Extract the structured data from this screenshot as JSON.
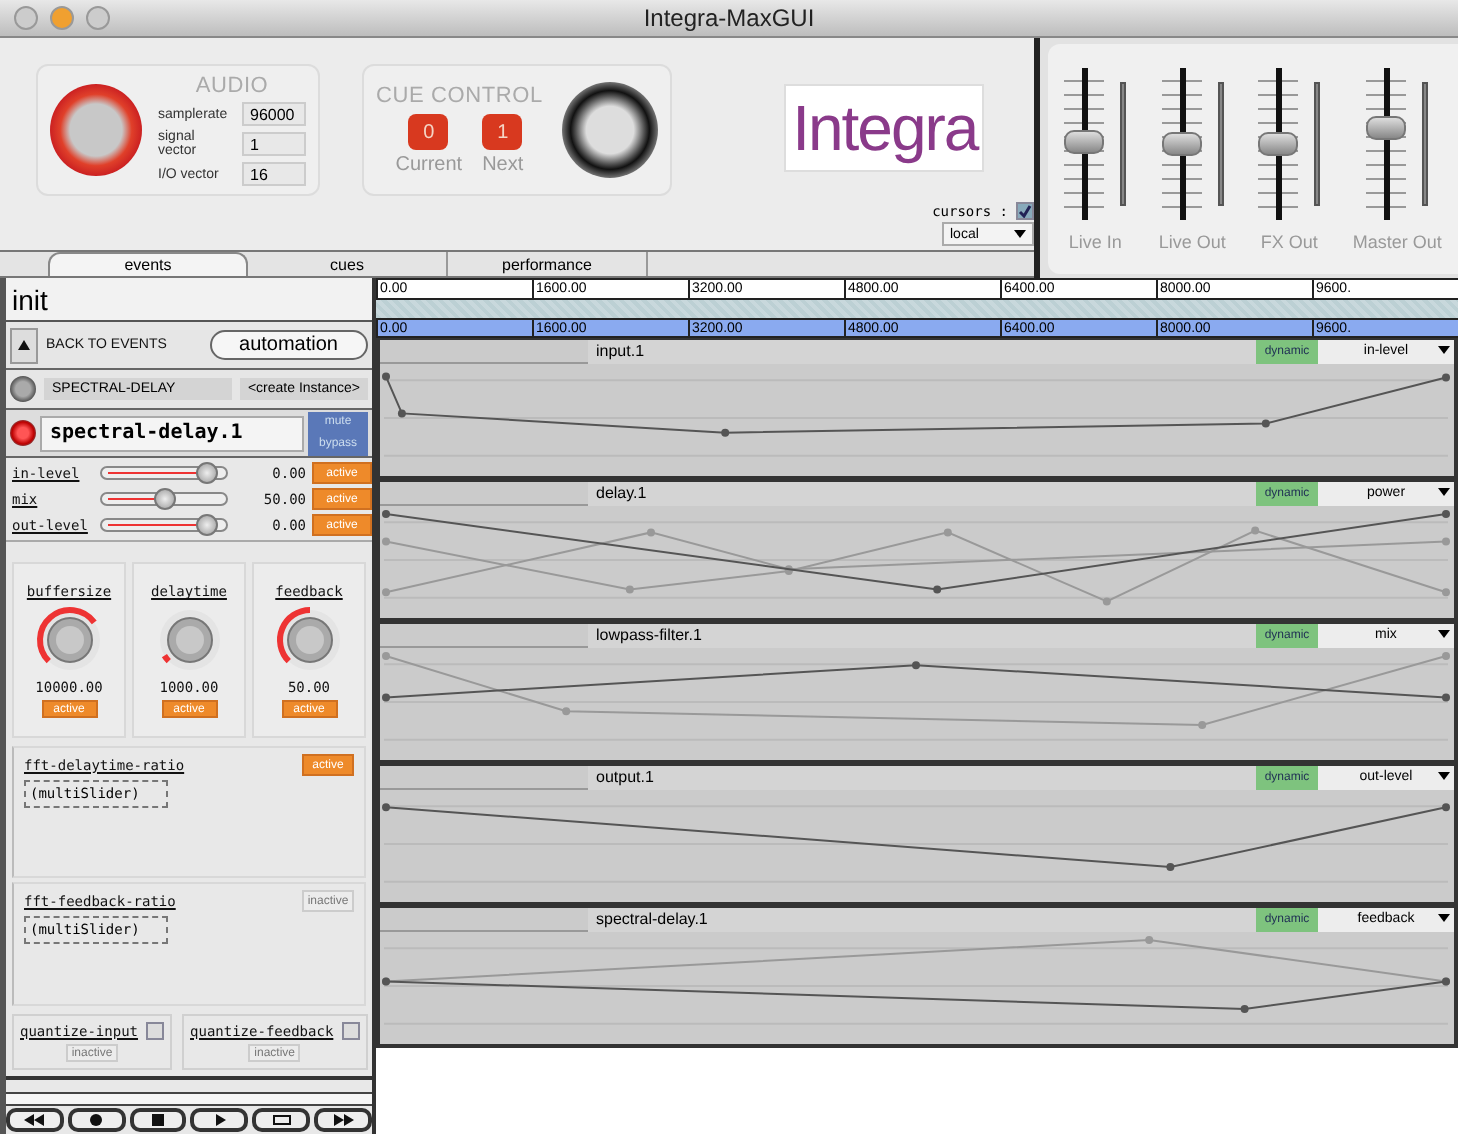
{
  "window": {
    "title": "Integra-MaxGUI"
  },
  "audio": {
    "title": "AUDIO",
    "on": true,
    "fields": [
      {
        "label": "samplerate",
        "value": "96000"
      },
      {
        "label": "signal vector",
        "value": "1"
      },
      {
        "label": "I/O vector",
        "value": "16"
      }
    ]
  },
  "cue_control": {
    "title": "CUE CONTROL",
    "cues": [
      {
        "value": "0",
        "label": "Current"
      },
      {
        "value": "1",
        "label": "Next"
      }
    ]
  },
  "logo": {
    "text": "Integra"
  },
  "cursors": {
    "label": "cursors :",
    "checked": true,
    "mode": "local"
  },
  "mixer": [
    {
      "name": "Live In",
      "level": 0.52
    },
    {
      "name": "Live Out",
      "level": 0.5
    },
    {
      "name": "FX Out",
      "level": 0.5
    },
    {
      "name": "Master Out",
      "level": 0.62
    }
  ],
  "tabs": [
    {
      "label": "events",
      "selected": true
    },
    {
      "label": "cues",
      "selected": false
    },
    {
      "label": "performance",
      "selected": false
    }
  ],
  "scene": {
    "title": "init",
    "back": "BACK TO EVENTS",
    "mode_button": "automation"
  },
  "module_picker": {
    "name": "SPECTRAL-DELAY",
    "action": "<create Instance>"
  },
  "module": {
    "name": "spectral-delay.1",
    "on": true,
    "buttons": [
      "mute",
      "bypass"
    ]
  },
  "sliders": [
    {
      "label": "in-level",
      "level": 0.9,
      "reading": "0.00",
      "active": true,
      "status": "active"
    },
    {
      "label": "mix",
      "level": 0.5,
      "reading": "50.00",
      "active": true,
      "status": "active"
    },
    {
      "label": "out-level",
      "level": 0.9,
      "reading": "0.00",
      "active": true,
      "status": "active"
    }
  ],
  "knobs": [
    {
      "label": "buffersize",
      "reading": "10000.00",
      "active": true,
      "status": "active"
    },
    {
      "label": "delaytime",
      "reading": "1000.00",
      "active": true,
      "status": "active"
    },
    {
      "label": "feedback",
      "reading": "50.00",
      "active": true,
      "status": "active"
    }
  ],
  "multisliders": [
    {
      "label": "fft-delaytime-ratio",
      "placeholder": "(multiSlider)",
      "active": true,
      "status": "active"
    },
    {
      "label": "fft-feedback-ratio",
      "placeholder": "(multiSlider)",
      "active": false,
      "status": "inactive"
    }
  ],
  "toggles": [
    {
      "label": "quantize-input",
      "checked": false,
      "active": false,
      "status": "inactive"
    },
    {
      "label": "quantize-feedback",
      "checked": false,
      "active": false,
      "status": "inactive"
    }
  ],
  "ruler": [
    "0.00",
    "1600.00",
    "3200.00",
    "4800.00",
    "6400.00",
    "8000.00",
    "9600."
  ],
  "selection_ruler": [
    "0.00",
    "1600.00",
    "3200.00",
    "4800.00",
    "6400.00",
    "8000.00",
    "9600."
  ],
  "lanes": [
    {
      "name": "input.1",
      "badge": "dynamic",
      "parameter": "in-level"
    },
    {
      "name": "delay.1",
      "badge": "dynamic",
      "parameter": "power"
    },
    {
      "name": "lowpass-filter.1",
      "badge": "dynamic",
      "parameter": "mix"
    },
    {
      "name": "output.1",
      "badge": "dynamic",
      "parameter": "out-level"
    },
    {
      "name": "spectral-delay.1",
      "badge": "dynamic",
      "parameter": "feedback"
    }
  ]
}
